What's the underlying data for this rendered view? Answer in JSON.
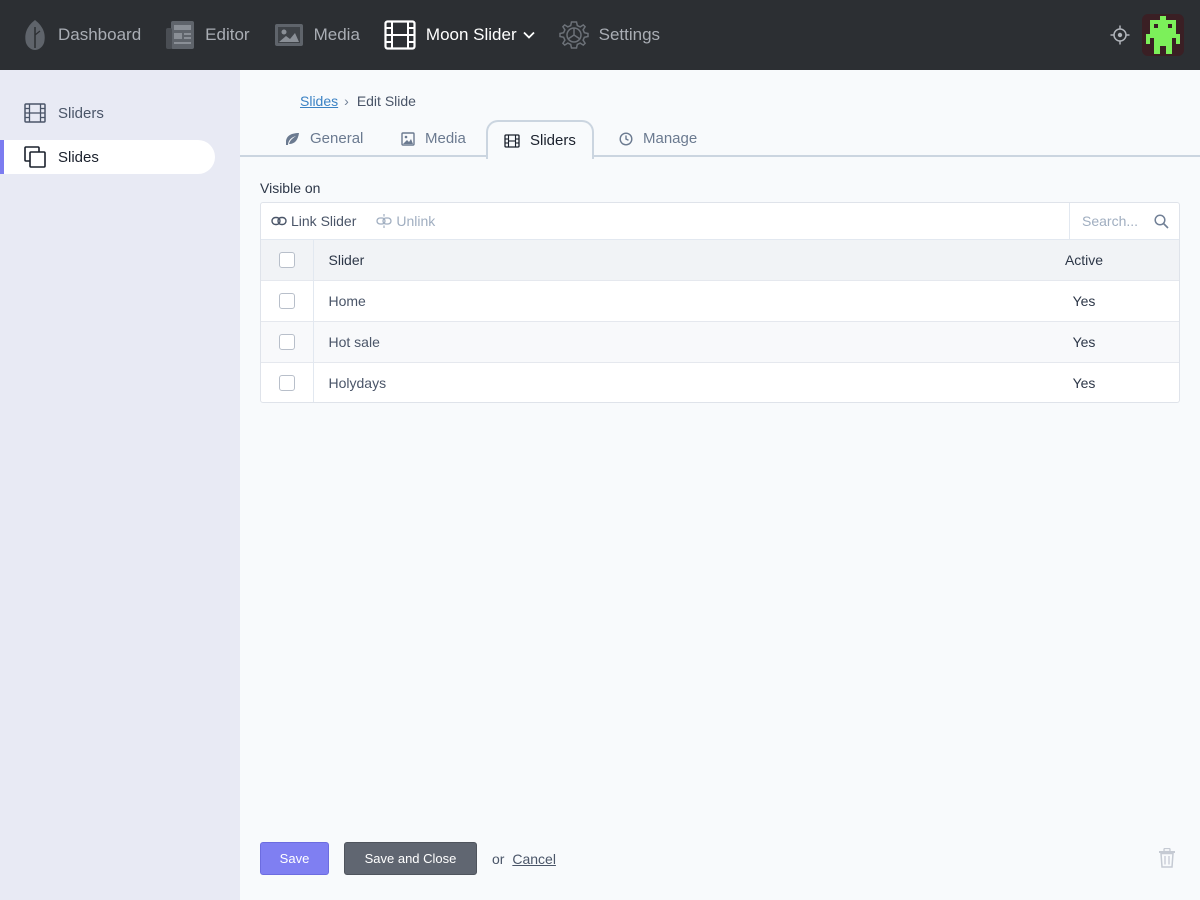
{
  "topnav": {
    "items": [
      {
        "label": "Dashboard",
        "icon": "leaf-icon"
      },
      {
        "label": "Editor",
        "icon": "newspaper-icon"
      },
      {
        "label": "Media",
        "icon": "image-icon"
      },
      {
        "label": "Moon Slider",
        "icon": "film-icon",
        "active": true
      },
      {
        "label": "Settings",
        "icon": "gear-icon"
      }
    ]
  },
  "sidebar": {
    "items": [
      {
        "label": "Sliders",
        "icon": "film-icon"
      },
      {
        "label": "Slides",
        "icon": "copy-icon",
        "active": true
      }
    ]
  },
  "breadcrumb": {
    "parent": "Slides",
    "separator": "›",
    "current": "Edit Slide"
  },
  "tabs": [
    {
      "label": "General",
      "icon": "leaf-icon"
    },
    {
      "label": "Media",
      "icon": "image-icon"
    },
    {
      "label": "Sliders",
      "icon": "film-icon",
      "active": true
    },
    {
      "label": "Manage",
      "icon": "clock-icon"
    }
  ],
  "visible_on": {
    "label": "Visible on",
    "link_button": "Link Slider",
    "unlink_button": "Unlink",
    "search_placeholder": "Search...",
    "columns": {
      "slider": "Slider",
      "active": "Active"
    },
    "rows": [
      {
        "slider": "Home",
        "active": "Yes"
      },
      {
        "slider": "Hot sale",
        "active": "Yes"
      },
      {
        "slider": "Holydays",
        "active": "Yes"
      }
    ]
  },
  "footer": {
    "save": "Save",
    "save_close": "Save and Close",
    "or": "or",
    "cancel": "Cancel"
  },
  "colors": {
    "topbar": "#2c2f33",
    "sidebar": "#e8eaf4",
    "accent": "#7f7ff2",
    "secondary_button": "#606671",
    "link": "#3b82c4"
  }
}
